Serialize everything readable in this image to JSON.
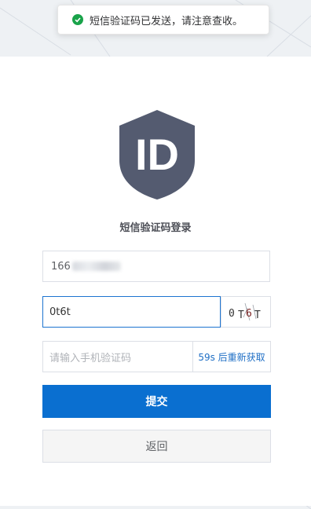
{
  "toast": {
    "message": "短信验证码已发送，请注意查收。",
    "icon": "check-circle-icon",
    "color": "#19a34a"
  },
  "logo": {
    "text": "ID",
    "icon": "shield-id-icon",
    "color": "#545b70"
  },
  "page": {
    "title": "短信验证码登录"
  },
  "form": {
    "phone_visible": "166",
    "captcha_value": "0t6t",
    "captcha_image_text": "0T6T",
    "sms_placeholder": "请输入手机验证码",
    "resend_label": "59s 后重新获取",
    "submit_label": "提交",
    "back_label": "返回"
  },
  "colors": {
    "primary": "#0a6fd0",
    "focus_border": "#1d74d0",
    "link": "#1f6fc5"
  }
}
